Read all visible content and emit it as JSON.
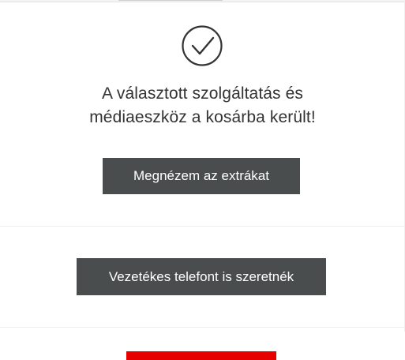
{
  "confirmation": {
    "icon": "check-circle-icon",
    "message_line1": "A választott szolgáltatás és",
    "message_line2": "médiaeszköz a kosárba került!"
  },
  "actions": {
    "view_extras_label": "Megnézem az extrákat",
    "landline_label": "Vezetékes telefont is szeretnék"
  },
  "colors": {
    "button_bg": "#4a4d4e",
    "button_text": "#ffffff",
    "accent_red": "#e60000",
    "text": "#333333"
  }
}
